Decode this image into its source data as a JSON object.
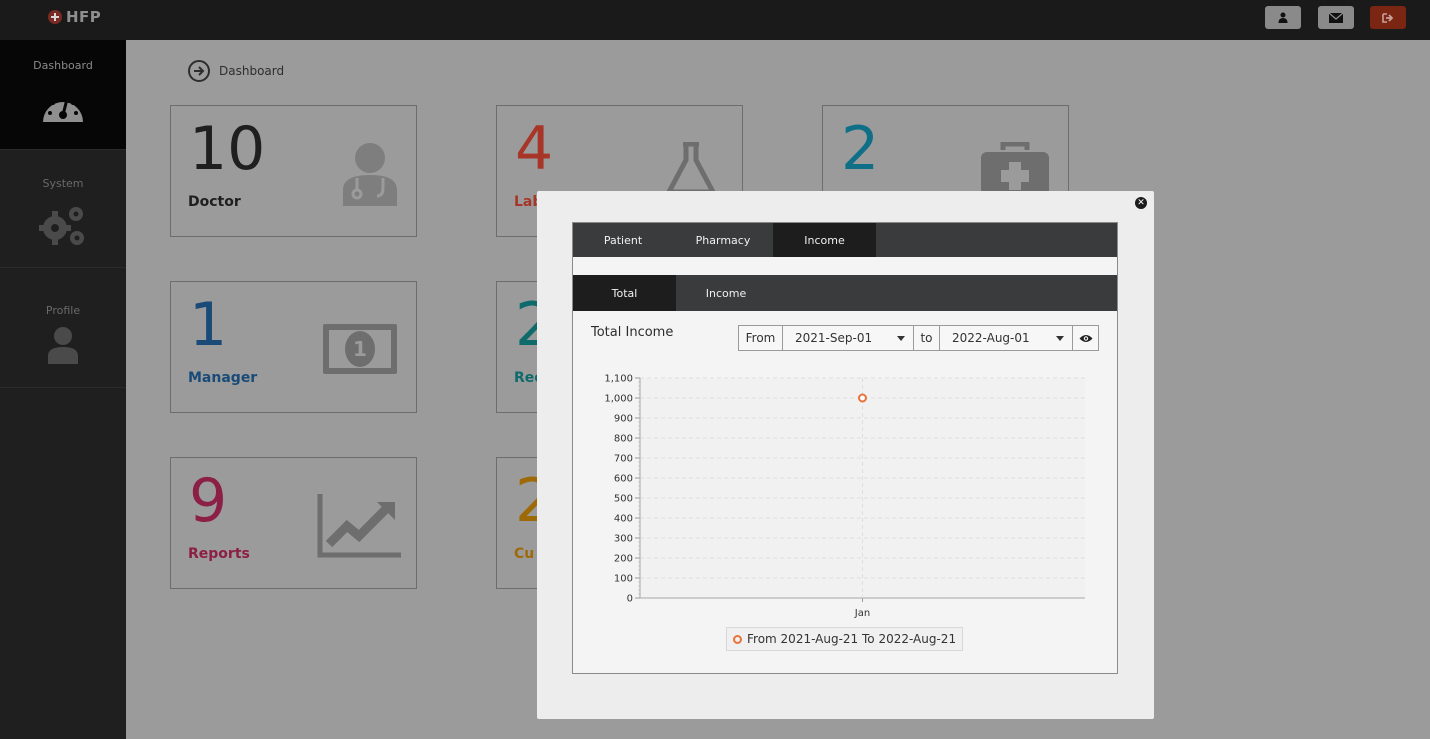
{
  "app": {
    "logo_text": "HFP"
  },
  "sidebar": {
    "items": [
      {
        "label": "Dashboard"
      },
      {
        "label": "System"
      },
      {
        "label": "Profile"
      }
    ]
  },
  "breadcrumb": {
    "label": "Dashboard"
  },
  "cards": [
    {
      "number": "10",
      "label": "Doctor",
      "color": "#1f1f1f"
    },
    {
      "number": "4",
      "label": "Lab",
      "color": "#a73628"
    },
    {
      "number": "2",
      "label": "",
      "color": "#0f6f87"
    },
    {
      "number": "1",
      "label": "Manager",
      "color": "#1a4b78"
    },
    {
      "number": "2",
      "label": "Rec",
      "color": "#0f6b6b"
    },
    {
      "number": "9",
      "label": "Reports",
      "color": "#8c1f45"
    },
    {
      "number": "2",
      "label": "Cu",
      "color": "#9e6a08"
    }
  ],
  "modal": {
    "tabs": [
      "Patient",
      "Pharmacy",
      "Income"
    ],
    "active_tab": "Income",
    "subtabs": [
      "Total",
      "Income"
    ],
    "active_subtab": "Total",
    "title": "Total Income",
    "filter": {
      "from_label": "From",
      "from_value": "2021-Sep-01",
      "to_label": "to",
      "to_value": "2022-Aug-01"
    },
    "legend_label": "From  2021-Aug-21  To  2022-Aug-21"
  },
  "chart_data": {
    "type": "line",
    "categories": [
      "Jan"
    ],
    "series": [
      {
        "name": "From  2021-Aug-21  To  2022-Aug-21",
        "values": [
          1000
        ],
        "color": "#e8743b"
      }
    ],
    "ylim": [
      0,
      1100
    ],
    "yticks": [
      "0",
      "100",
      "200",
      "300",
      "400",
      "500",
      "600",
      "700",
      "800",
      "900",
      "1,000",
      "1,100"
    ],
    "grid": true,
    "legend_position": "bottom"
  }
}
